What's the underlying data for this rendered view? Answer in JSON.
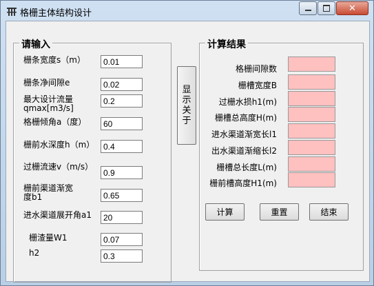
{
  "window": {
    "title": "格栅主体结构设计",
    "icon": "grid-icon"
  },
  "input_group": {
    "title": "请输入",
    "fields": [
      {
        "label": "栅条宽度s（m）",
        "value": "0.01"
      },
      {
        "label": "栅条净间隙e",
        "value": "0.02"
      },
      {
        "label": "最大设计流量\nqmax[m3/s]",
        "value": "0.2"
      },
      {
        "label": "格栅倾角a（度）",
        "value": "60"
      },
      {
        "label": "栅前水深度h（m）",
        "value": "0.4"
      },
      {
        "label": "过栅流速v（m/s）",
        "value": "0.9"
      },
      {
        "label": "栅前渠道渐宽\n度b1",
        "value": "0.65"
      },
      {
        "label": "进水渠道展开角a1",
        "value": "20"
      },
      {
        "label": "栅渣量W1",
        "value": "0.07"
      },
      {
        "label": "h2",
        "value": "0.3"
      }
    ]
  },
  "show_button": {
    "label": "显示关于"
  },
  "result_group": {
    "title": "计算结果",
    "rows": [
      {
        "label": "格栅间隙数",
        "value": ""
      },
      {
        "label": "栅槽宽度B",
        "value": ""
      },
      {
        "label": "过栅水损h1(m)",
        "value": ""
      },
      {
        "label": "栅槽总高度H(m)",
        "value": ""
      },
      {
        "label": "进水渠道渐宽长l1",
        "value": ""
      },
      {
        "label": "出水渠道渐缩长l2",
        "value": ""
      },
      {
        "label": "栅槽总长度L(m)",
        "value": ""
      },
      {
        "label": "栅前槽高度H1(m)",
        "value": ""
      }
    ]
  },
  "buttons": {
    "calc": "计算",
    "reset": "重置",
    "end": "结束"
  },
  "colors": {
    "result_bg": "#ffc0c0"
  }
}
